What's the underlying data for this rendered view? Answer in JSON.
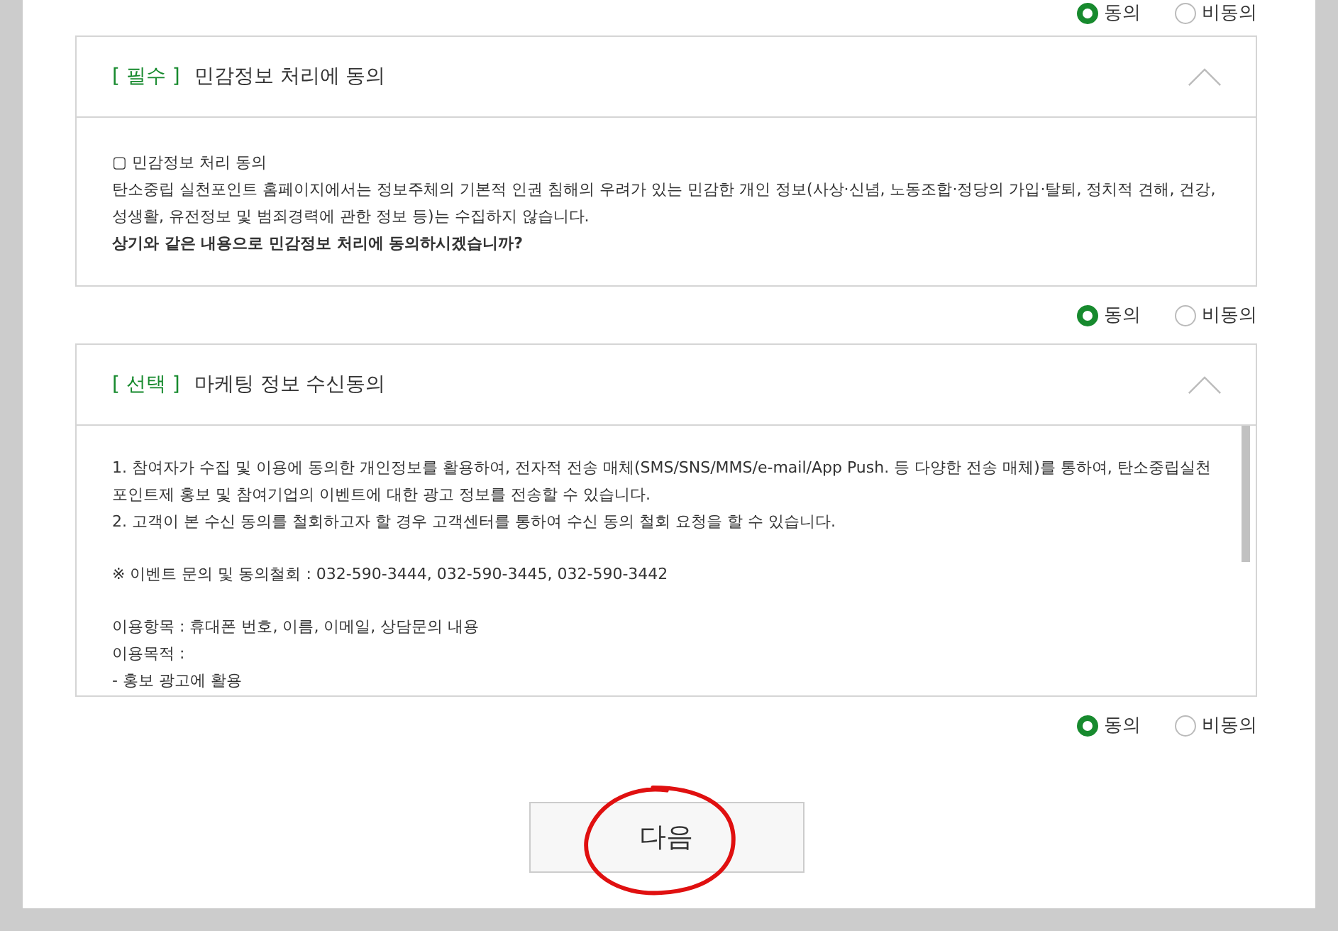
{
  "top_choice": {
    "options": [
      {
        "label": "동의",
        "selected": true
      },
      {
        "label": "비동의",
        "selected": false
      }
    ]
  },
  "sections": [
    {
      "badge": "[ 필수 ]",
      "title": "민감정보 처리에 동의",
      "expanded": true,
      "scrollable": false,
      "blocks": [
        [
          {
            "kind": "text",
            "text": "▢ 민감정보 처리 동의"
          },
          {
            "kind": "text",
            "text": "탄소중립 실천포인트 홈페이지에서는 정보주체의 기본적 인권 침해의 우려가 있는 민감한 개인 정보(사상·신념, 노동조합·정당의 가입·탈퇴, 정치적 견해, 건강, 성생활, 유전정보 및 범죄경력에 관한 정보 등)는 수집하지 않습니다."
          },
          {
            "kind": "bold",
            "text": "상기와 같은 내용으로 민감정보 처리에 동의하시겠습니까?"
          }
        ]
      ],
      "choice": {
        "options": [
          {
            "label": "동의",
            "selected": true
          },
          {
            "label": "비동의",
            "selected": false
          }
        ]
      }
    },
    {
      "badge": "[ 선택 ]",
      "title": "마케팅 정보 수신동의",
      "expanded": true,
      "scrollable": true,
      "blocks": [
        [
          {
            "kind": "text",
            "text": "1. 참여자가 수집 및 이용에 동의한 개인정보를 활용하여, 전자적 전송 매체(SMS/SNS/MMS/e-mail/App Push. 등 다양한 전송 매체)를 통하여, 탄소중립실천포인트제 홍보 및 참여기업의 이벤트에 대한 광고 정보를 전송할 수 있습니다."
          },
          {
            "kind": "text",
            "text": "2. 고객이 본 수신 동의를 철회하고자 할 경우 고객센터를 통하여 수신 동의 철회 요청을 할 수 있습니다."
          }
        ],
        [
          {
            "kind": "text",
            "text": "※ 이벤트 문의 및 동의철회 : 032-590-3444, 032-590-3445, 032-590-3442"
          }
        ],
        [
          {
            "kind": "text",
            "text": "이용항목 : 휴대폰 번호, 이름, 이메일, 상담문의 내용"
          },
          {
            "kind": "text",
            "text": "이용목적 :"
          },
          {
            "kind": "text",
            "text": "- 홍보 광고에 활용"
          }
        ]
      ],
      "choice": {
        "options": [
          {
            "label": "동의",
            "selected": true
          },
          {
            "label": "비동의",
            "selected": false
          }
        ]
      }
    }
  ],
  "next_button": {
    "label": "다음",
    "circled": true
  }
}
